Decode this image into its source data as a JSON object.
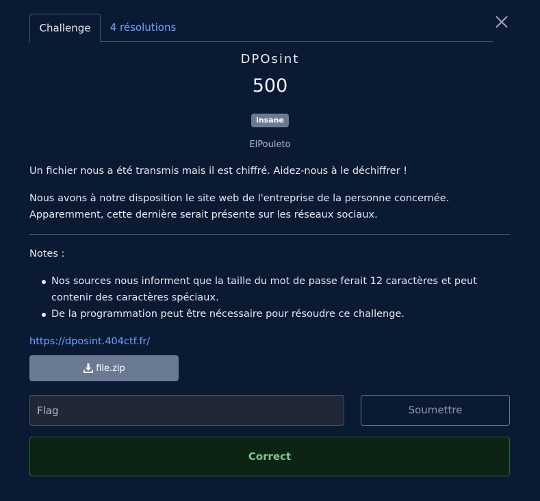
{
  "tabs": [
    {
      "label": "Challenge",
      "active": true
    },
    {
      "label": "4 résolutions",
      "active": false
    }
  ],
  "challenge": {
    "name": "DPOsint",
    "points": "500",
    "difficulty": "insane",
    "author": "ElPouleto",
    "description": [
      "Un fichier nous a été transmis mais il est chiffré. Aidez-nous à le déchiffrer !",
      "Nous avons à notre disposition le site web de l'entreprise de la personne concernée. Apparemment, cette dernière serait présente sur les réseaux sociaux."
    ],
    "notes_label": "Notes :",
    "notes": [
      "Nos sources nous informent que la taille du mot de passe ferait 12 caractères et peut contenir des caractères spéciaux.",
      "De la programmation peut être nécessaire pour résoudre ce challenge."
    ],
    "link": "https://dposint.404ctf.fr/",
    "file": "file.zip"
  },
  "form": {
    "flag_placeholder": "Flag",
    "flag_value": "",
    "submit_label": "Soumettre"
  },
  "result": "Correct",
  "colors": {
    "background": "#0b1a33",
    "link": "#6ea4ff",
    "badge": "#6b7a93",
    "success_bg": "#0d2414",
    "success_border": "#1f6b35",
    "success_text": "#7fc794"
  },
  "icons": {
    "close": "close-icon",
    "download": "download-icon"
  }
}
